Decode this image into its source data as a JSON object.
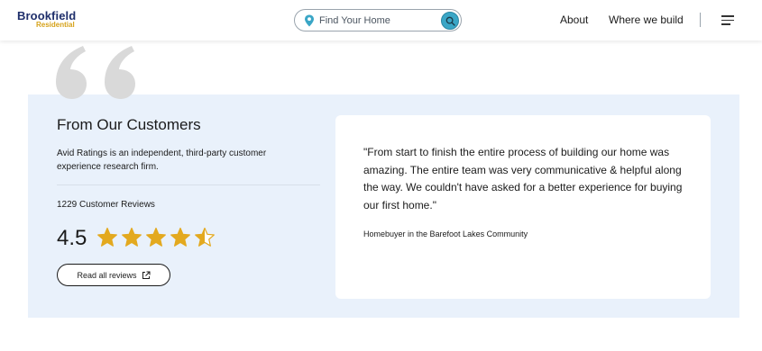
{
  "header": {
    "logo_main": "Brookfield",
    "logo_sub": "Residential",
    "search_placeholder": "Find Your Home",
    "nav": {
      "about": "About",
      "where": "Where we build"
    },
    "icons": {
      "pin": "location-pin-icon",
      "search": "search-icon",
      "menu": "hamburger-menu-icon"
    }
  },
  "colors": {
    "brand_navy": "#1f2f6b",
    "brand_gold": "#d6a21a",
    "panel_bg": "#e9f1fb",
    "search_button": "#3aa6c6",
    "star": "#e3a91f",
    "quote_mark": "#d9d9d9"
  },
  "testimonials": {
    "title": "From Our Customers",
    "description": "Avid Ratings is an independent, third-party customer experience research firm.",
    "review_count": "1229 Customer Reviews",
    "rating": "4.5",
    "rating_value": 4.5,
    "rating_max": 5,
    "read_all_label": "Read all reviews",
    "quote": "\"From start to finish the entire process of building our home was amazing. The entire team was very communicative & helpful along the way. We couldn't have asked for a better experience for buying our first home.\"",
    "quote_author": "Homebuyer in the Barefoot Lakes Community"
  }
}
